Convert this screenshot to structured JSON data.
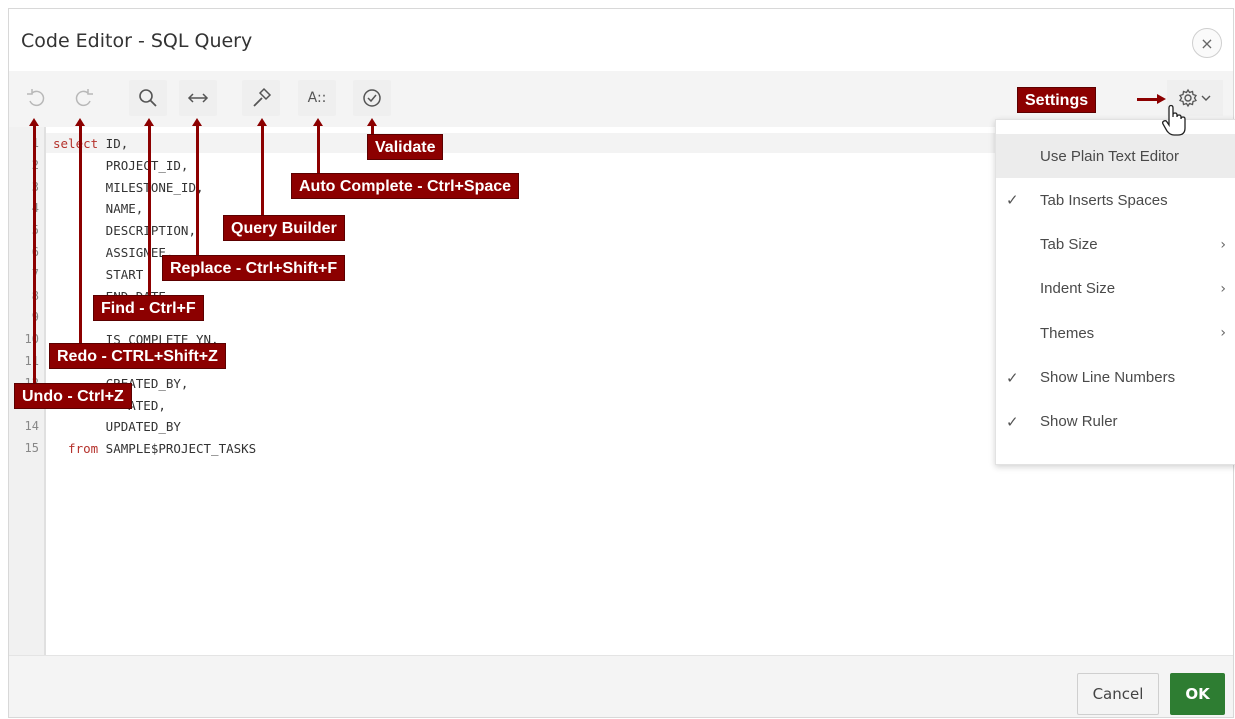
{
  "dialog": {
    "title": "Code Editor - SQL Query",
    "close_label": "×"
  },
  "toolbar": {
    "undo_icon": "undo-icon",
    "redo_icon": "redo-icon",
    "find_icon": "search-icon",
    "replace_icon": "replace-icon",
    "query_builder_icon": "hammer-icon",
    "autocomplete_label": "A::",
    "validate_icon": "check-circle-icon",
    "settings_icon": "gear-icon"
  },
  "editor": {
    "lines": [
      {
        "num": "1",
        "kw": "select",
        "text": " ID,"
      },
      {
        "num": "2",
        "kw": "",
        "text": "       PROJECT_ID,"
      },
      {
        "num": "3",
        "kw": "",
        "text": "       MILESTONE_ID,"
      },
      {
        "num": "4",
        "kw": "",
        "text": "       NAME,"
      },
      {
        "num": "5",
        "kw": "",
        "text": "       DESCRIPTION,"
      },
      {
        "num": "6",
        "kw": "",
        "text": "       ASSIGNEE,"
      },
      {
        "num": "7",
        "kw": "",
        "text": "       START"
      },
      {
        "num": "8",
        "kw": "",
        "text": "       END_DATE,"
      },
      {
        "num": "9",
        "kw": "",
        "text": ""
      },
      {
        "num": "10",
        "kw": "",
        "text": "       IS_COMPLETE_YN,"
      },
      {
        "num": "11",
        "kw": "",
        "text": ""
      },
      {
        "num": "12",
        "kw": "",
        "text": "       CREATED_BY,"
      },
      {
        "num": "13",
        "kw": "",
        "text": "          ATED,"
      },
      {
        "num": "14",
        "kw": "",
        "text": "       UPDATED_BY"
      },
      {
        "num": "15",
        "kw": "  from",
        "text": " SAMPLE$PROJECT_TASKS"
      }
    ]
  },
  "settings_menu": {
    "items": [
      {
        "label": "Use Plain Text Editor",
        "checked": "",
        "arrow": ""
      },
      {
        "label": "Tab Inserts Spaces",
        "checked": "✓",
        "arrow": ""
      },
      {
        "label": "Tab Size",
        "checked": "",
        "arrow": "›"
      },
      {
        "label": "Indent Size",
        "checked": "",
        "arrow": "›"
      },
      {
        "label": "Themes",
        "checked": "",
        "arrow": "›"
      },
      {
        "label": "Show Line Numbers",
        "checked": "✓",
        "arrow": ""
      },
      {
        "label": "Show Ruler",
        "checked": "✓",
        "arrow": ""
      }
    ]
  },
  "footer": {
    "cancel_label": "Cancel",
    "ok_label": "OK"
  },
  "callouts": {
    "settings": "Settings",
    "validate": "Validate",
    "autocomplete": "Auto Complete - Ctrl+Space",
    "query_builder": "Query Builder",
    "replace": "Replace - Ctrl+Shift+F",
    "find": "Find - Ctrl+F",
    "redo": "Redo - CTRL+Shift+Z",
    "undo": "Undo - Ctrl+Z"
  },
  "colors": {
    "callout": "#8c0000",
    "ok_button": "#2e7d32",
    "keyword": "#b5322c"
  }
}
